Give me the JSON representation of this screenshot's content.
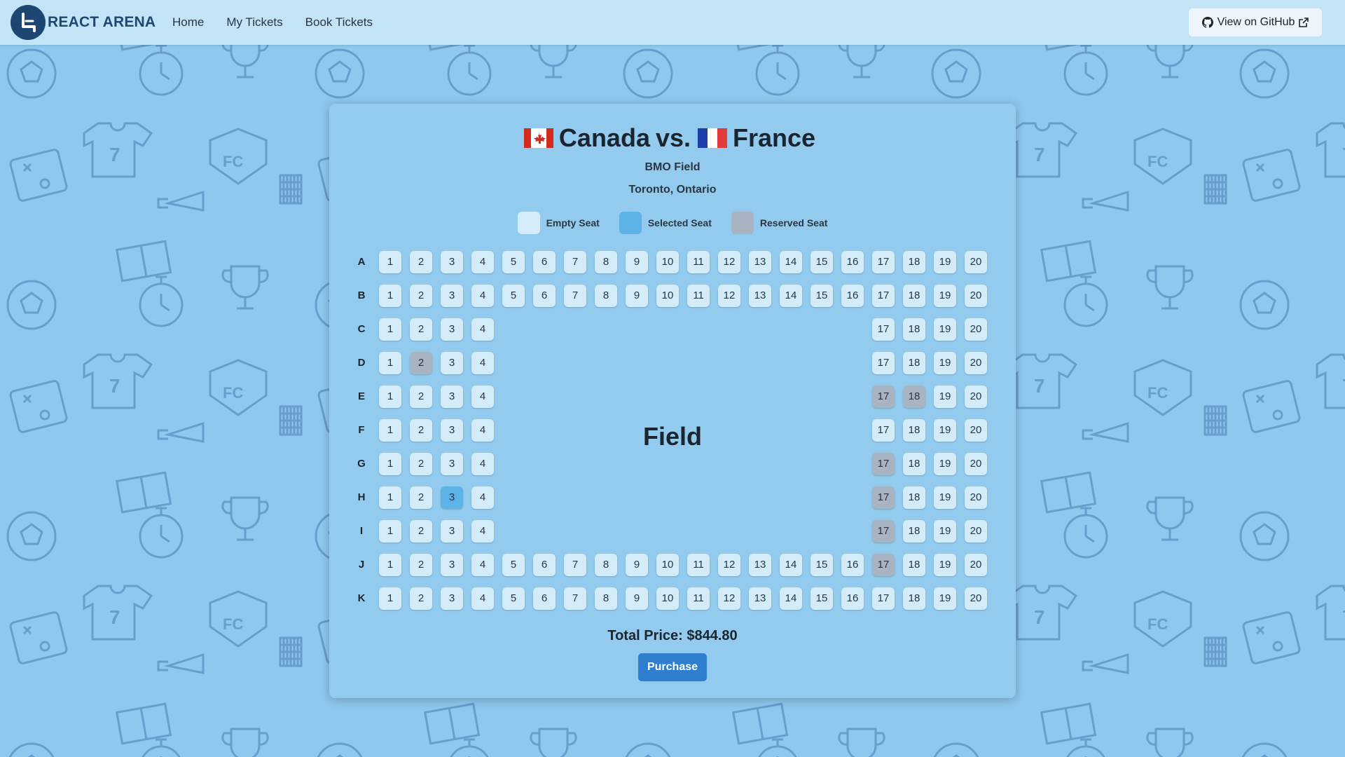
{
  "app": {
    "name": "REACT ARENA"
  },
  "nav": {
    "links": [
      {
        "label": "Home"
      },
      {
        "label": "My Tickets"
      },
      {
        "label": "Book Tickets"
      }
    ],
    "github_label": "View on GitHub"
  },
  "match": {
    "home_team": "Canada",
    "vs": "vs.",
    "away_team": "France",
    "venue": "BMO Field",
    "city": "Toronto, Ontario"
  },
  "legend": {
    "empty": "Empty Seat",
    "selected": "Selected Seat",
    "reserved": "Reserved Seat"
  },
  "seating": {
    "rows": [
      "A",
      "B",
      "C",
      "D",
      "E",
      "F",
      "G",
      "H",
      "I",
      "J",
      "K"
    ],
    "full_rows": [
      "A",
      "B",
      "J",
      "K"
    ],
    "seats_per_row": 20,
    "side_seats": [
      1,
      2,
      3,
      4,
      17,
      18,
      19,
      20
    ],
    "reserved": [
      "D2",
      "E17",
      "E18",
      "G17",
      "H17",
      "I17",
      "J17"
    ],
    "selected": [
      "H3"
    ]
  },
  "field_label": "Field",
  "total_price": "Total Price: $844.80",
  "purchase_label": "Purchase",
  "colors": {
    "background": "#8ec8ee",
    "navbar": "#c3e4f7",
    "empty_seat": "#d4ecfa",
    "selected_seat": "#5db2e8",
    "reserved_seat": "#a9b4c2",
    "primary_button": "#2f7fcf",
    "pattern": "#5a8fc1"
  }
}
